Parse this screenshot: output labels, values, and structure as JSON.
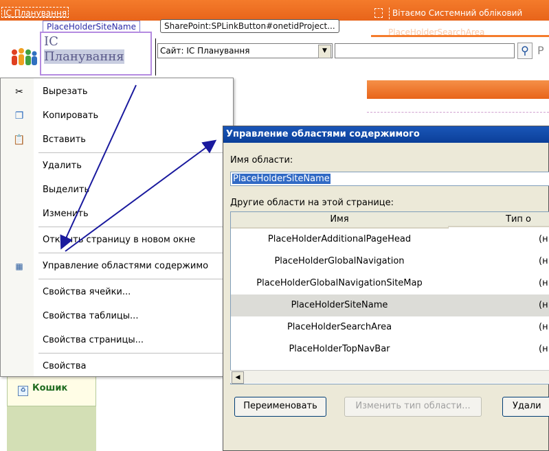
{
  "page": {
    "site_title_tag": "IC Планування",
    "welcome": "Вітаємо Системний обліковий",
    "placeholder_tag": "PlaceHolderSiteName",
    "spbutton_tag": "SharePoint:SPLinkButton#onetidProject...",
    "search_area_tag": "PlaceHolderSearchArea",
    "site_name_line1": "IC",
    "site_name_line2": "Планування",
    "scope_select_value": "Сайт: IC Планування",
    "search_placeholder": "",
    "search_trailing": "P",
    "recycle_bin": "Кошик"
  },
  "context_menu": {
    "items": [
      {
        "label": "Вырезать",
        "icon": "scissors-icon"
      },
      {
        "label": "Копировать",
        "icon": "copy-icon"
      },
      {
        "label": "Вставить",
        "icon": "paste-icon"
      },
      {
        "label": "Удалить",
        "icon": ""
      },
      {
        "label": "Выделить",
        "icon": ""
      },
      {
        "label": "Изменить",
        "icon": ""
      },
      {
        "label": "Открыть страницу в новом окне",
        "icon": ""
      },
      {
        "label": "Управление областями содержимо",
        "icon": "content-regions-icon"
      },
      {
        "label": "Свойства ячейки...",
        "icon": ""
      },
      {
        "label": "Свойства таблицы...",
        "icon": ""
      },
      {
        "label": "Свойства страницы...",
        "icon": ""
      },
      {
        "label": "Свойства",
        "icon": ""
      }
    ]
  },
  "dialog": {
    "title": "Управление областями содержимого",
    "area_name_label": "Имя области:",
    "area_name_value": "PlaceHolderSiteName",
    "other_areas_label": "Другие области на этой странице:",
    "columns": [
      "Имя",
      "Тип о"
    ],
    "rows": [
      {
        "name": "PlaceHolderAdditionalPageHead",
        "type": "(н"
      },
      {
        "name": "PlaceHolderGlobalNavigation",
        "type": "(н"
      },
      {
        "name": "PlaceHolderGlobalNavigationSiteMap",
        "type": "(н"
      },
      {
        "name": "PlaceHolderSiteName",
        "type": "(н",
        "selected": true
      },
      {
        "name": "PlaceHolderSearchArea",
        "type": "(н"
      },
      {
        "name": "PlaceHolderTopNavBar",
        "type": "(н"
      }
    ],
    "buttons": {
      "rename": "Переименовать",
      "change_type": "Изменить тип области...",
      "delete": "Удали"
    }
  },
  "colors": {
    "orange": "#f47b2b",
    "arrow": "#1a1a9e",
    "dialog_title": "#0b3f99",
    "selection": "#316ac5"
  }
}
